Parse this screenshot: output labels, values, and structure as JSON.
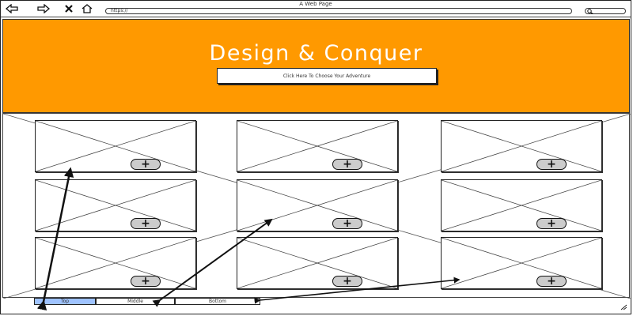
{
  "window": {
    "title": "A Web Page"
  },
  "browser": {
    "url": "https://",
    "icons": {
      "back": "back-arrow-icon",
      "forward": "forward-arrow-icon",
      "close": "close-icon",
      "home": "home-icon",
      "search": "search-icon"
    }
  },
  "hero": {
    "title": "Design & Conquer",
    "button_label": "Click Here To Choose Your Adventure",
    "background_color": "#ff9900"
  },
  "tiles": [
    {
      "add_label": "+"
    },
    {
      "add_label": "+"
    },
    {
      "add_label": "+"
    },
    {
      "add_label": "+"
    },
    {
      "add_label": "+"
    },
    {
      "add_label": "+"
    },
    {
      "add_label": "+"
    },
    {
      "add_label": "+"
    },
    {
      "add_label": "+"
    }
  ],
  "tabs": [
    {
      "label": "Top",
      "active": true
    },
    {
      "label": "Middle",
      "active": false
    },
    {
      "label": "Bottom",
      "active": false
    }
  ],
  "colors": {
    "active_tab": "#9fc3ff",
    "add_button": "#cccccc"
  }
}
